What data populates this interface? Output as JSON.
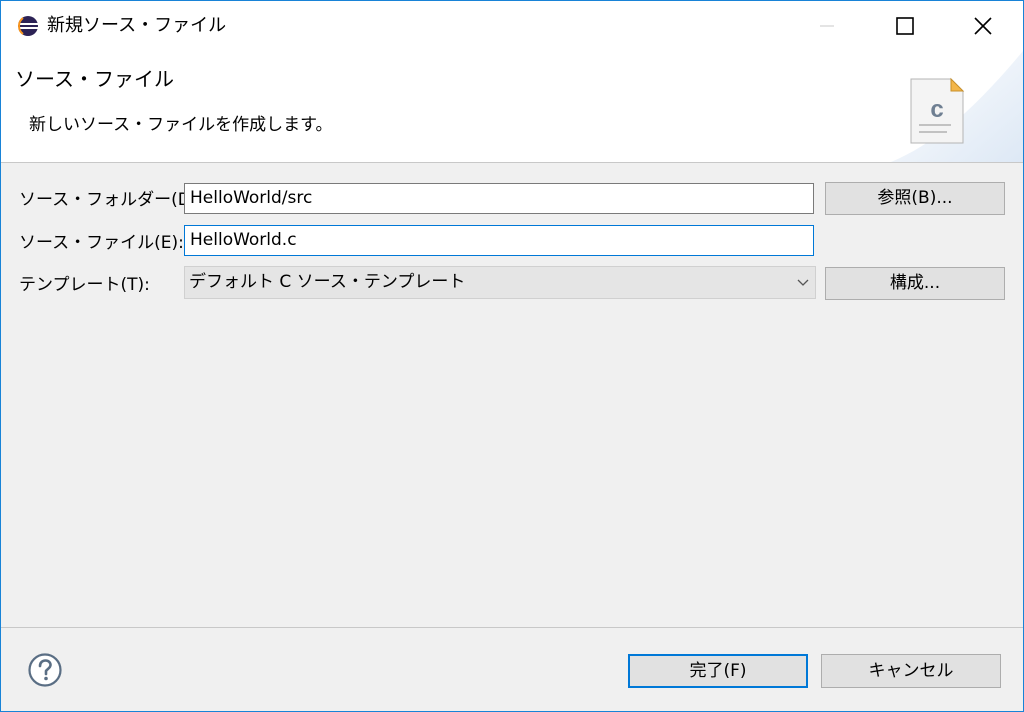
{
  "window": {
    "title": "新規ソース・ファイル"
  },
  "banner": {
    "title": "ソース・ファイル",
    "description": "新しいソース・ファイルを作成します。",
    "file_icon_letter": "c"
  },
  "form": {
    "source_folder_label": "ソース・フォルダー(D):",
    "source_folder_value": "HelloWorld/src",
    "browse_label": "参照(B)...",
    "source_file_label": "ソース・ファイル(E):",
    "source_file_value": "HelloWorld.c",
    "template_label": "テンプレート(T):",
    "template_value": "デフォルト C ソース・テンプレート",
    "configure_label": "構成..."
  },
  "footer": {
    "finish_label": "完了(F)",
    "cancel_label": "キャンセル"
  },
  "colors": {
    "accent": "#0078d7",
    "window_border": "#1883d7",
    "background": "#f0f0f0"
  },
  "icons": [
    "eclipse-icon",
    "minimize-icon",
    "maximize-icon",
    "close-icon",
    "c-source-file-icon",
    "chevron-down-icon",
    "help-icon"
  ]
}
